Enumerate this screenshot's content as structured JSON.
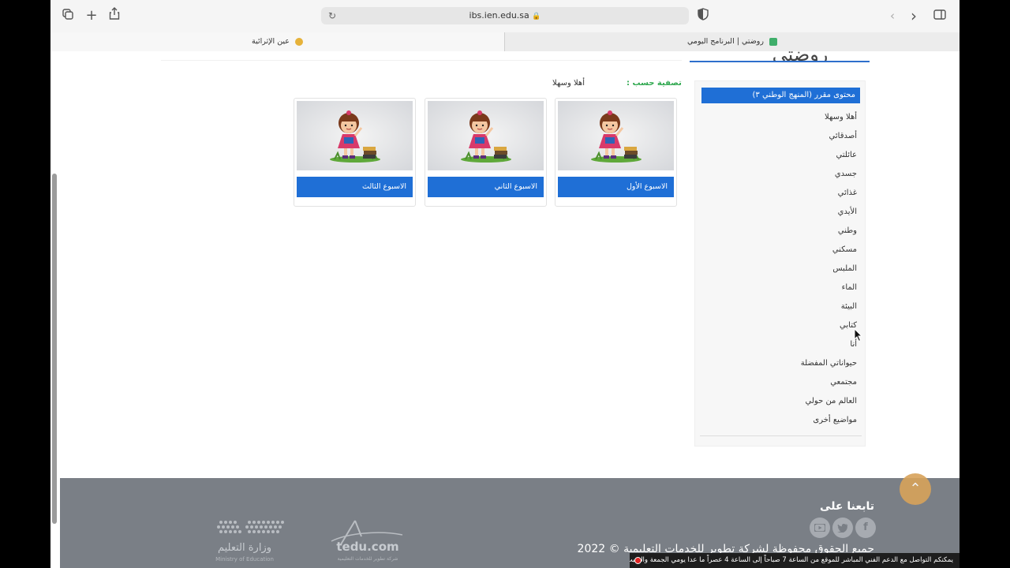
{
  "browser": {
    "url": "ibs.ien.edu.sa",
    "tabs": [
      {
        "label": "عين الإثرائية",
        "active": false
      },
      {
        "label": "روضتي | البرنامج اليومي",
        "active": true
      }
    ]
  },
  "sidebar": {
    "header": "محتوى مقرر (المنهج الوطني ٣)",
    "items": [
      "أهلا وسهلا",
      "أصدقائي",
      "عائلتي",
      "جسدي",
      "غذائي",
      "الأيدي",
      "وطني",
      "مسكني",
      "الملبس",
      "الماء",
      "البيئة",
      "كتابي",
      "أنا",
      "حيواناتي المفضلة",
      "مجتمعي",
      "العالم من حولي",
      "مواضيع أخرى"
    ]
  },
  "filter": {
    "label": "تصفية حسب :",
    "value": "أهلا وسهلا"
  },
  "cards": [
    {
      "label": "الاسبوع الأول"
    },
    {
      "label": "الاسبوع الثاني"
    },
    {
      "label": "الاسبوع الثالث"
    }
  ],
  "footer": {
    "follow_title": "تابعنا على",
    "copyright": "جميع الحقوق محفوظة لشركة تطوير للخدمات التعليمية © 2022",
    "logo_tedu": "tedu.com",
    "logo_tedu_sub": "شركة تطوير للخدمات التعليمية",
    "logo_moe": "وزارة التعليم",
    "logo_moe_sub": "Ministry of Education"
  },
  "banner": {
    "text": "يمكنكم التواصل مع الدعم الفني المباشر للموقع من الساعة 7 صباحاً إلى الساعة 4 عصراً ما عدا يومي الجمعة والسبت"
  },
  "colors": {
    "primary": "#1f6fd6",
    "filter_label": "#2fa84f",
    "footer_bg": "#7a7f86",
    "scroll_top": "#d8a35a"
  },
  "icons": [
    "tabs-overview-icon",
    "new-tab-icon",
    "share-icon",
    "reload-icon",
    "lock-icon",
    "shield-icon",
    "back-icon",
    "forward-icon",
    "sidebar-toggle-icon",
    "youtube-icon",
    "twitter-icon",
    "facebook-icon",
    "arrow-up-icon"
  ]
}
